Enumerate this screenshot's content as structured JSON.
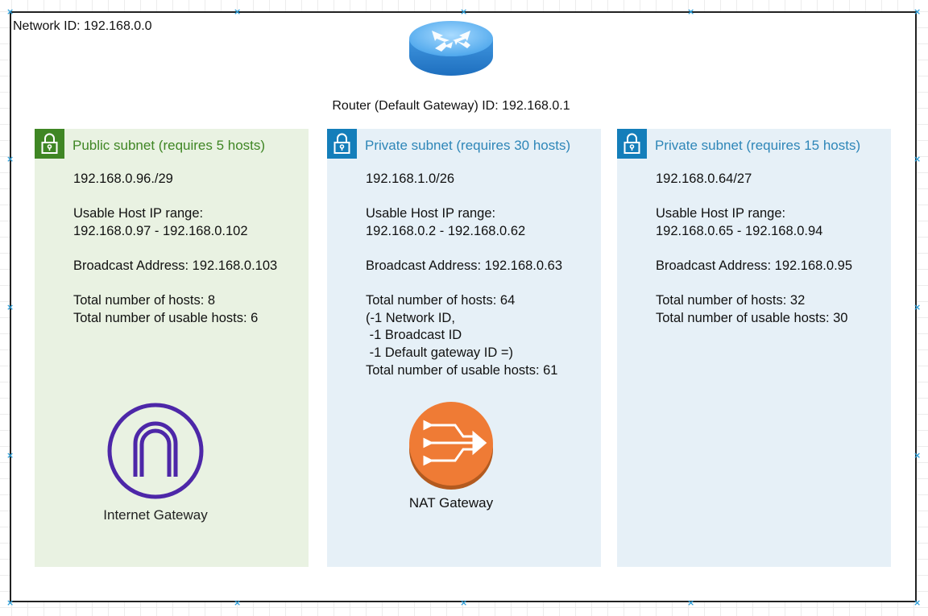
{
  "network": {
    "id_label": "Network ID: 192.168.0.0"
  },
  "router": {
    "label": "Router (Default Gateway) ID: 192.168.0.1",
    "icon": "router-icon"
  },
  "subnets": [
    {
      "title": "Public subnet (requires 5 hosts)",
      "icon": "lock-icon",
      "details": "192.168.0.96./29\n\nUsable Host IP range:\n192.168.0.97 - 192.168.0.102\n\nBroadcast Address: 192.168.0.103\n\nTotal number of hosts: 8\nTotal number of usable hosts: 6",
      "component": {
        "icon": "internet-gateway-icon",
        "label": "Internet Gateway"
      }
    },
    {
      "title": "Private subnet (requires 30 hosts)",
      "icon": "lock-icon",
      "details": "192.168.1.0/26\n\nUsable Host IP range:\n192.168.0.2 - 192.168.0.62\n\nBroadcast Address: 192.168.0.63\n\nTotal number of hosts: 64\n(-1 Network ID,\n -1 Broadcast ID\n -1 Default gateway ID =)\nTotal number of usable hosts: 61",
      "component": {
        "icon": "nat-gateway-icon",
        "label": "NAT Gateway"
      }
    },
    {
      "title": "Private subnet (requires 15 hosts)",
      "icon": "lock-icon",
      "details": "192.168.0.64/27\n\nUsable Host IP range:\n192.168.0.65 - 192.168.0.94\n\nBroadcast Address: 192.168.0.95\n\nTotal number of hosts: 32\nTotal number of usable hosts: 30"
    }
  ],
  "colors": {
    "public_accent": "#3f8624",
    "public_bg": "#e9f2e2",
    "private_accent": "#147eba",
    "private_bg": "#e6f0f7",
    "igw_purple": "#4d27a8",
    "nat_orange": "#ef7b35",
    "router_blue": "#3a8fd9"
  }
}
